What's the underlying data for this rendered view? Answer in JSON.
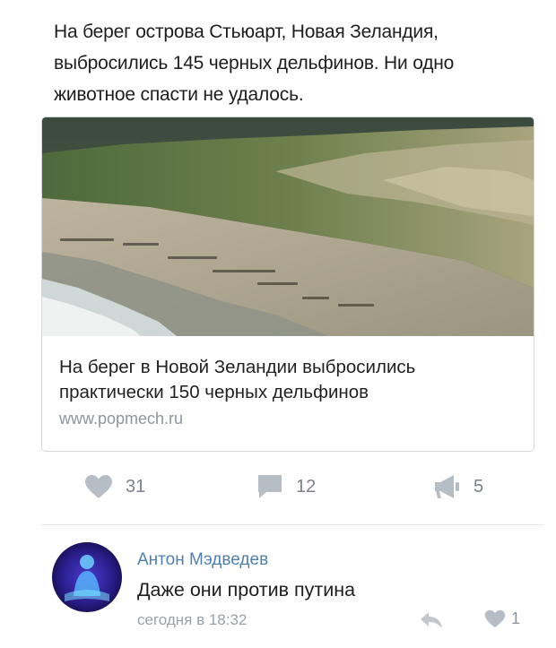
{
  "post": {
    "text": "На берег острова Стьюарт, Новая Зеландия, выбросились 145 черных дельфинов. Ни одно животное спасти не удалось."
  },
  "link_card": {
    "title": "На берег в Новой Зеландии выбросились практически 150 черных дельфинов",
    "url": "www.popmech.ru"
  },
  "actions": {
    "likes": "31",
    "comments": "12",
    "shares": "5"
  },
  "comment": {
    "author": "Антон Мэдведев",
    "text": "Даже они против путина",
    "time": "сегодня в 18:32",
    "likes": "1"
  },
  "colors": {
    "link_blue": "#4f80b1",
    "icon_gray": "#b7bdc4",
    "muted_text": "#8d959f"
  }
}
